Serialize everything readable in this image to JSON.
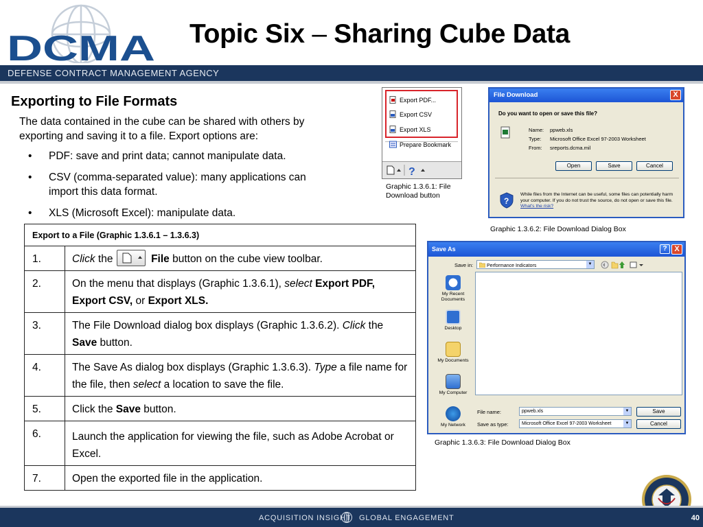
{
  "header": {
    "logo_text": "DCMA",
    "title_a": "Topic Six",
    "title_dash": "–",
    "title_b": "Sharing Cube Data",
    "agency": "DEFENSE CONTRACT MANAGEMENT AGENCY"
  },
  "content": {
    "heading": "Exporting to File Formats",
    "intro": "The data contained in the cube can be shared with others by exporting and saving it to a file. Export options are:",
    "bullets": [
      "PDF: save and print data; cannot manipulate data.",
      "CSV (comma-separated value): many applications can import this data format.",
      "XLS (Microsoft Excel): manipulate data."
    ],
    "bullet_glyph": "•"
  },
  "table": {
    "header": "Export to a File (Graphic 1.3.6.1 – 1.3.6.3)",
    "rows": [
      {
        "num": "1.",
        "a": "Click",
        "b": " the ",
        "c": "File",
        "d": " button on the cube view toolbar."
      },
      {
        "num": "2.",
        "a": " On the menu that displays (Graphic 1.3.6.1), ",
        "b": "select",
        "c": " ",
        "d": "Export PDF, Export CSV,",
        "e": " or ",
        "f": "Export XLS."
      },
      {
        "num": "3.",
        "a": "The File Download dialog box displays (Graphic 1.3.6.2). ",
        "b": "Click",
        "c": " the ",
        "d": "Save",
        "e": " button."
      },
      {
        "num": "4.",
        "a": "The Save As dialog box displays (Graphic 1.3.6.3). ",
        "b": "Type",
        "c": " a file name for the file, then ",
        "d": "select",
        "e": " a location to save the file."
      },
      {
        "num": "5.",
        "a": "Click the ",
        "b": "Save",
        "c": " button."
      },
      {
        "num": "6.",
        "a": "Launch the application for viewing the file, such as Adobe Acrobat or Excel."
      },
      {
        "num": "7.",
        "a": " Open the exported file in the application."
      }
    ]
  },
  "graphic1": {
    "items": [
      "Export PDF...",
      "Export CSV",
      "Export XLS",
      "Prepare Bookmark"
    ],
    "help_glyph": "?",
    "caption": "Graphic 1.3.6.1: File Download button"
  },
  "graphic2": {
    "title": "File Download",
    "close": "X",
    "question": "Do you want to open or save this file?",
    "name_label": "Name:",
    "name_value": "ppweb.xls",
    "type_label": "Type:",
    "type_value": "Microsoft Office Excel 97-2003 Worksheet",
    "from_label": "From:",
    "from_value": "sreports.dcma.mil",
    "buttons": [
      "Open",
      "Save",
      "Cancel"
    ],
    "warning": "While files from the Internet can be useful, some files can potentially harm your computer. If you do not trust the source, do not open or save this file. ",
    "risk_link": "What's the risk?",
    "caption": "Graphic 1.3.6.2: File Download Dialog Box"
  },
  "graphic3": {
    "title": "Save As",
    "help": "?",
    "close": "X",
    "save_in_label": "Save in:",
    "save_in_value": "Performance Indicators",
    "places": [
      "My Recent Documents",
      "Desktop",
      "My Documents",
      "My Computer",
      "My Network"
    ],
    "file_name_label": "File name:",
    "file_name_value": "ppweb.xls",
    "save_type_label": "Save as type:",
    "save_type_value": "Microsoft Office Excel 97-2003 Worksheet",
    "save_button": "Save",
    "cancel_button": "Cancel",
    "caption": "Graphic 1.3.6.3: File Download Dialog Box"
  },
  "footer": {
    "left": "ACQUISITION INSIGHT",
    "right": "GLOBAL ENGAGEMENT",
    "page": "40"
  },
  "colors": {
    "navy": "#1b365d",
    "red": "#d8232a",
    "xp_blue": "#1d55d5"
  }
}
